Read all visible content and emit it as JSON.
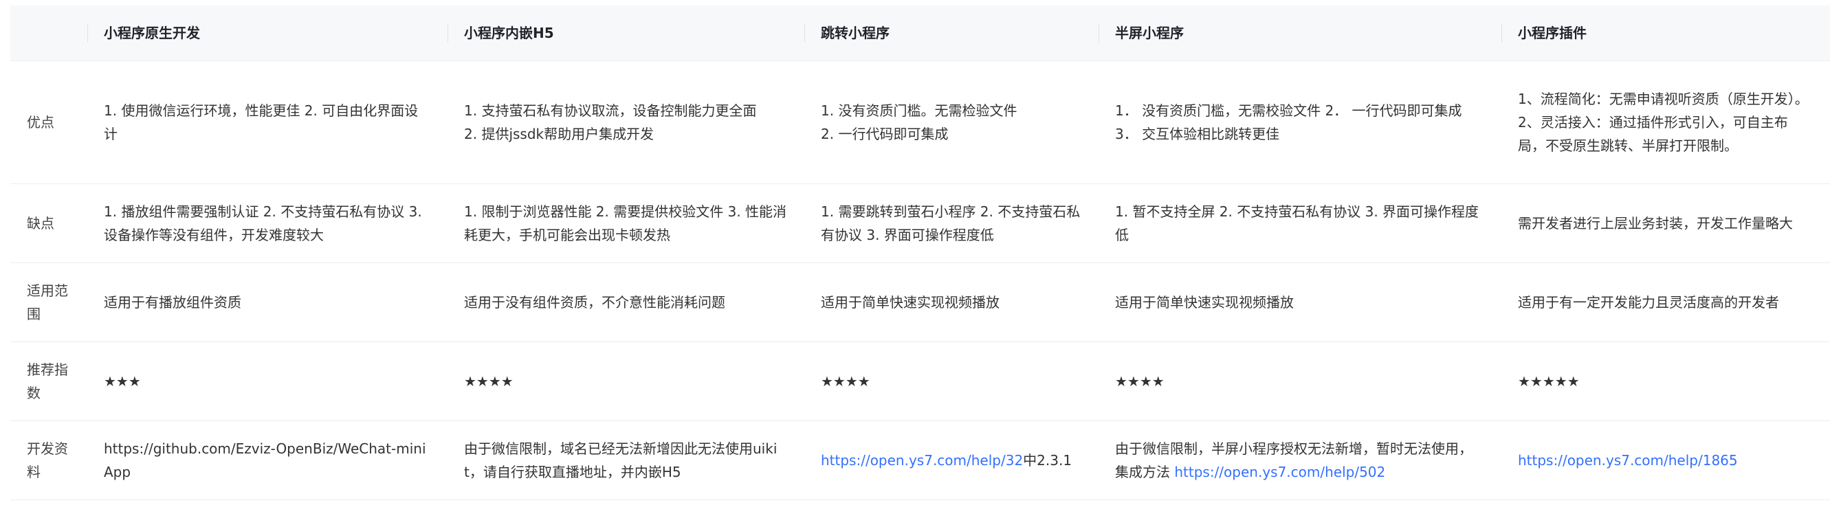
{
  "table": {
    "headers": [
      "",
      "小程序原生开发",
      "小程序内嵌H5",
      "跳转小程序",
      "半屏小程序",
      "小程序插件"
    ],
    "rows": {
      "advantages": {
        "label": "优点",
        "native": "1. 使用微信运行环境，性能更佳 2. 可自由化界面设计",
        "h5_line1": "1. 支持萤石私有协议取流，设备控制能力更全面",
        "h5_line2": "2. 提供jssdk帮助用户集成开发",
        "jump_line1": "1. 没有资质门槛。无需检验文件",
        "jump_line2": "2. 一行代码即可集成",
        "half": "1． 没有资质门槛，无需校验文件 2． 一行代码即可集成 3． 交互体验相比跳转更佳",
        "plugin_line1": "1、流程简化：无需申请视听资质（原生开发）。",
        "plugin_line2": "2、灵活接入：通过插件形式引入，可自主布局，不受原生跳转、半屏打开限制。"
      },
      "disadvantages": {
        "label": "缺点",
        "native": "1. 播放组件需要强制认证 2. 不支持萤石私有协议 3. 设备操作等没有组件，开发难度较大",
        "h5": "1. 限制于浏览器性能 2. 需要提供校验文件 3. 性能消耗更大，手机可能会出现卡顿发热",
        "jump": "1. 需要跳转到萤石小程序 2. 不支持萤石私有协议 3. 界面可操作程度低",
        "half": "1. 暂不支持全屏 2. 不支持萤石私有协议 3. 界面可操作程度低",
        "plugin": "需开发者进行上层业务封装，开发工作量略大"
      },
      "scope": {
        "label": "适用范围",
        "native": "适用于有播放组件资质",
        "h5": "适用于没有组件资质，不介意性能消耗问题",
        "jump": "适用于简单快速实现视频播放",
        "half": "适用于简单快速实现视频播放",
        "plugin": "适用于有一定开发能力且灵活度高的开发者"
      },
      "recommend": {
        "label": "推荐指数",
        "native": "★★★",
        "h5": "★★★★",
        "jump": "★★★★",
        "half": "★★★★",
        "plugin": "★★★★★"
      },
      "docs": {
        "label": "开发资料",
        "native": "https://github.com/Ezviz-OpenBiz/WeChat-miniApp",
        "h5": "由于微信限制，域名已经无法新增因此无法使用uikit，请自行获取直播地址，并内嵌H5",
        "jump_link": "https://open.ys7.com/help/32",
        "jump_suffix": "中2.3.1",
        "half_text": "由于微信限制，半屏小程序授权无法新增，暂时无法使用，集成方法 ",
        "half_link": "https://open.ys7.com/help/502",
        "plugin_link": "https://open.ys7.com/help/1865"
      }
    }
  },
  "colors": {
    "header_bg": "#f7f8fa",
    "border": "#ebedf0",
    "link": "#3370ff",
    "text": "#333333"
  }
}
